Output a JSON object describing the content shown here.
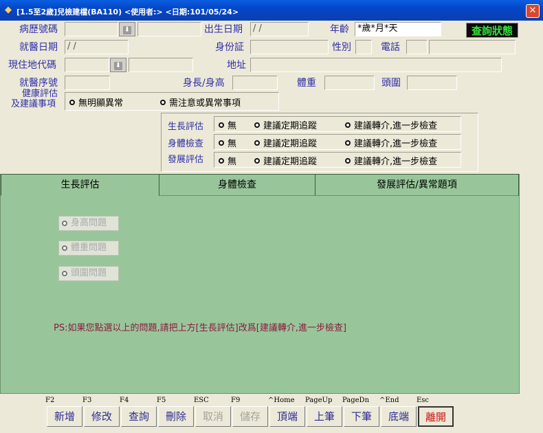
{
  "window": {
    "title": "[1.5至2歲]兒檢建檔(BA110)   <使用者:>    <日期:101/05/24>",
    "close": "✕"
  },
  "form": {
    "chart_no_label": "病歷號碼",
    "birth_date_label": "出生日期",
    "birth_date_value": "/ /",
    "age_label": "年齡",
    "age_value": "*歲*月*天",
    "query_status": "查詢狀態",
    "visit_date_label": "就醫日期",
    "visit_date_value": "/ /",
    "id_label": "身份証",
    "sex_label": "性別",
    "phone_label": "電話",
    "area_code_label": "現住地代碼",
    "address_label": "地址",
    "visit_seq_label": "就醫序號",
    "height_label": "身長/身高",
    "weight_label": "體重",
    "head_label": "頭圍",
    "health_eval_label_1": "健康評估",
    "health_eval_label_2": "及建議事項",
    "health_opt_1": "無明顯異常",
    "health_opt_2": "需注意或異常事項"
  },
  "evaluations": {
    "rows": [
      {
        "label": "生長評估",
        "opt1": "無",
        "opt2": "建議定期追蹤",
        "opt3": "建議轉介,進一步檢查"
      },
      {
        "label": "身體檢查",
        "opt1": "無",
        "opt2": "建議定期追蹤",
        "opt3": "建議轉介,進一步檢查"
      },
      {
        "label": "發展評估",
        "opt1": "無",
        "opt2": "建議定期追蹤",
        "opt3": "建議轉介,進一步檢查"
      }
    ]
  },
  "tabs": [
    {
      "label": "生長評估"
    },
    {
      "label": "身體檢查"
    },
    {
      "label": "發展評估/異常題項"
    }
  ],
  "growth_tab": {
    "checks": [
      "身高問題",
      "體重問題",
      "頭圍問題"
    ],
    "note": "PS:如果您點選以上的問題,請把上方[生長評估]改爲[建議轉介,進一步檢查]"
  },
  "toolbar": {
    "buttons": [
      {
        "key": "F2",
        "label": "新增"
      },
      {
        "key": "F3",
        "label": "修改"
      },
      {
        "key": "F4",
        "label": "查詢"
      },
      {
        "key": "F5",
        "label": "刪除"
      },
      {
        "key": "ESC",
        "label": "取消"
      },
      {
        "key": "F9",
        "label": "儲存"
      },
      {
        "key": "^Home",
        "label": "頂端"
      },
      {
        "key": "PageUp",
        "label": "上筆"
      },
      {
        "key": "PageDn",
        "label": "下筆"
      },
      {
        "key": "^End",
        "label": "底端"
      },
      {
        "key": "Esc",
        "label": "離開"
      }
    ]
  }
}
